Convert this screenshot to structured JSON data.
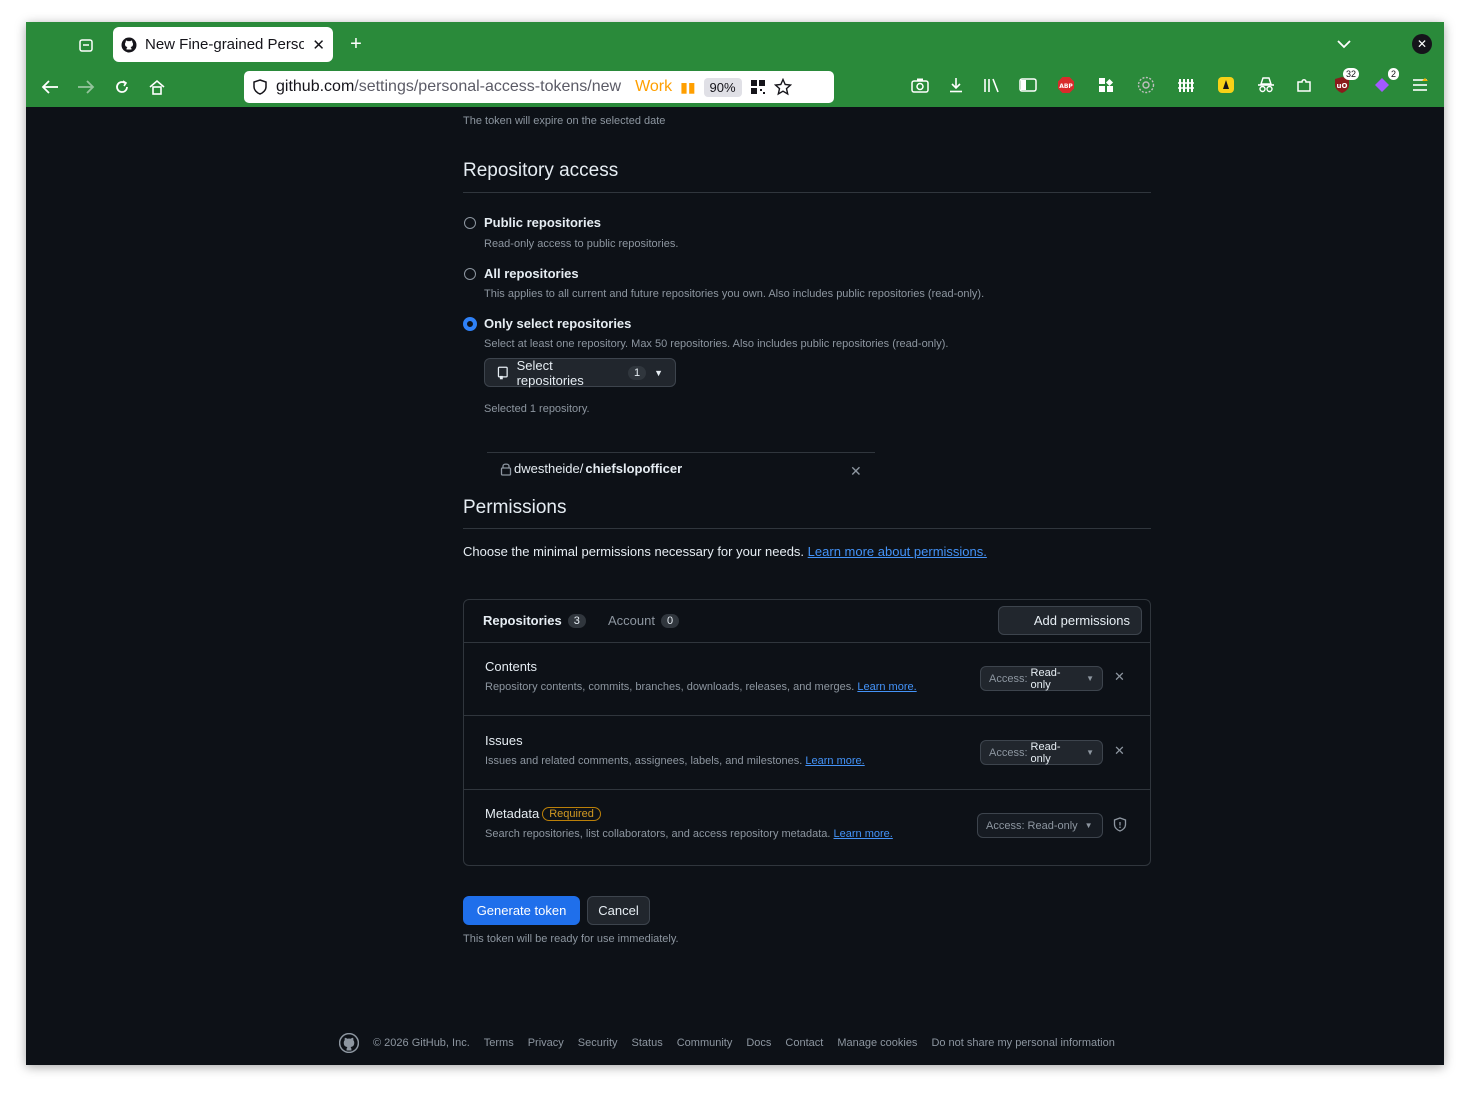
{
  "browser": {
    "tab_title": "New Fine-grained Perso",
    "url_host": "github.com",
    "url_path": "/settings/personal-access-tokens/new",
    "container": "Work",
    "zoom": "90%",
    "badge_ublock": "32",
    "badge_ext": "2"
  },
  "expiry_note": "The token will expire on the selected date",
  "repo_access": {
    "title": "Repository access",
    "options": [
      {
        "label": "Public repositories",
        "desc": "Read-only access to public repositories."
      },
      {
        "label": "All repositories",
        "desc": "This applies to all current and future repositories you own. Also includes public repositories (read-only)."
      },
      {
        "label": "Only select repositories",
        "desc": "Select at least one repository. Max 50 repositories. Also includes public repositories (read-only)."
      }
    ],
    "select_button": "Select repositories",
    "select_count": "1",
    "selected_note": "Selected 1 repository.",
    "repo_owner": "dwestheide/",
    "repo_name": "chiefslopofficer"
  },
  "permissions": {
    "title": "Permissions",
    "intro": "Choose the minimal permissions necessary for your needs.",
    "intro_link": "Learn more about permissions.",
    "tabs": [
      {
        "label": "Repositories",
        "count": "3"
      },
      {
        "label": "Account",
        "count": "0"
      }
    ],
    "add_button": "Add permissions",
    "rows": [
      {
        "name": "Contents",
        "desc": "Repository contents, commits, branches, downloads, releases, and merges.",
        "link": "Learn more.",
        "access_prefix": "Access:",
        "access": "Read-only"
      },
      {
        "name": "Issues",
        "desc": "Issues and related comments, assignees, labels, and milestones.",
        "link": "Learn more.",
        "access_prefix": "Access:",
        "access": "Read-only"
      },
      {
        "name": "Metadata",
        "badge": "Required",
        "desc": "Search repositories, list collaborators, and access repository metadata.",
        "link": "Learn more.",
        "access_prefix": "Access:",
        "access": "Read-only"
      }
    ]
  },
  "actions": {
    "generate": "Generate token",
    "cancel": "Cancel",
    "note": "This token will be ready for use immediately."
  },
  "footer": {
    "copyright": "© 2026 GitHub, Inc.",
    "links": [
      "Terms",
      "Privacy",
      "Security",
      "Status",
      "Community",
      "Docs",
      "Contact",
      "Manage cookies",
      "Do not share my personal information"
    ]
  }
}
